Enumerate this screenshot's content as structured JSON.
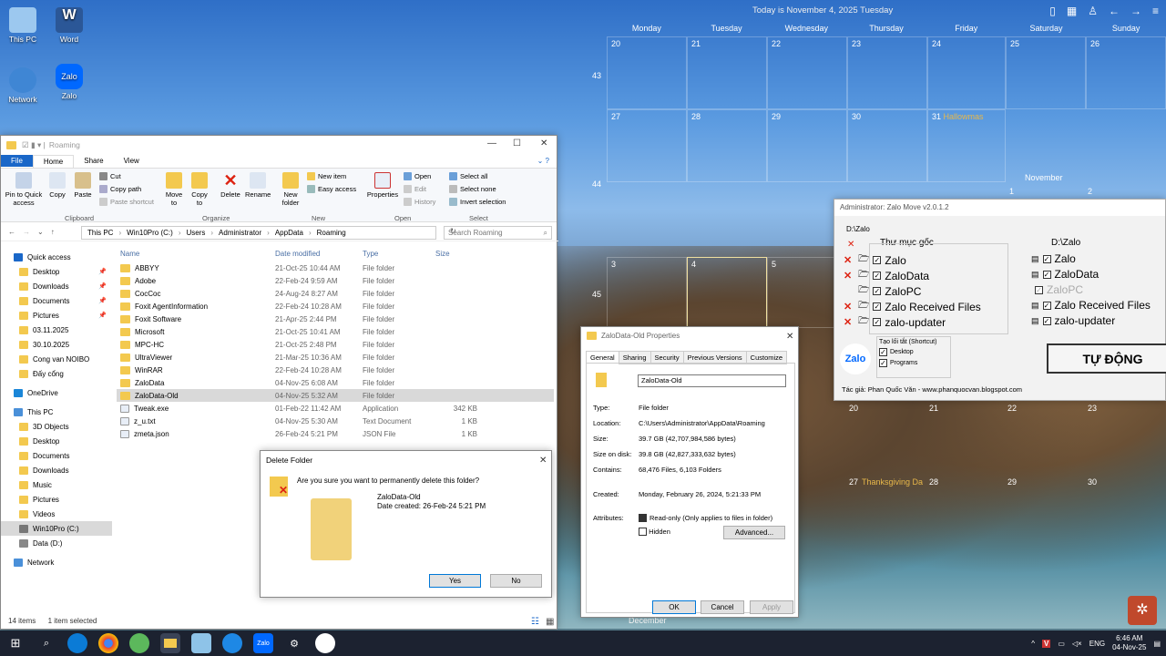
{
  "desktop": {
    "icons": [
      {
        "label": "This PC"
      },
      {
        "label": "Word"
      },
      {
        "label": "Network"
      },
      {
        "label": "Zalo"
      }
    ]
  },
  "calendar": {
    "today": "Today is November 4, 2025 Tuesday",
    "days": [
      "Monday",
      "Tuesday",
      "Wednesday",
      "Thursday",
      "Friday",
      "Saturday",
      "Sunday"
    ],
    "weeks": [
      "43",
      "44",
      "45"
    ],
    "row1": [
      "20",
      "21",
      "22",
      "23",
      "24",
      "25",
      "26"
    ],
    "row2": [
      "27",
      "28",
      "29",
      "30",
      "31",
      "",
      ""
    ],
    "event_halloween": "Hallowmas",
    "month_label": "November",
    "row2b": [
      "1",
      "2"
    ],
    "row3": [
      "3",
      "4",
      "5"
    ],
    "row4": [
      "20",
      "21",
      "22",
      "23"
    ],
    "row5": [
      "27",
      "28",
      "29",
      "30"
    ],
    "event_thanks": "Thanksgiving Da",
    "december": "December"
  },
  "explorer": {
    "title": "Roaming",
    "tabs": [
      "File",
      "Home",
      "Share",
      "View"
    ],
    "ribbon": {
      "pin": "Pin to Quick access",
      "copy": "Copy",
      "paste": "Paste",
      "cut": "Cut",
      "copy_path": "Copy path",
      "paste_shortcut": "Paste shortcut",
      "clipboard": "Clipboard",
      "move_to": "Move to",
      "copy_to": "Copy to",
      "delete": "Delete",
      "rename": "Rename",
      "organize": "Organize",
      "new_folder": "New folder",
      "new_item": "New item",
      "easy_access": "Easy access",
      "new": "New",
      "properties": "Properties",
      "open": "Open",
      "edit": "Edit",
      "history": "History",
      "open_grp": "Open",
      "select_all": "Select all",
      "select_none": "Select none",
      "invert": "Invert selection",
      "select": "Select"
    },
    "path": [
      "This PC",
      "Win10Pro (C:)",
      "Users",
      "Administrator",
      "AppData",
      "Roaming"
    ],
    "search": "Search Roaming",
    "nav": [
      {
        "label": "Quick access",
        "pin": false
      },
      {
        "label": "Desktop",
        "pin": true
      },
      {
        "label": "Downloads",
        "pin": true
      },
      {
        "label": "Documents",
        "pin": true
      },
      {
        "label": "Pictures",
        "pin": true
      },
      {
        "label": "03.11.2025",
        "pin": false
      },
      {
        "label": "30.10.2025",
        "pin": false
      },
      {
        "label": "Cong van NOIBO",
        "pin": false
      },
      {
        "label": "Đấy cổng",
        "pin": false
      },
      {
        "label": "OneDrive",
        "pin": false
      },
      {
        "label": "This PC",
        "pin": false
      },
      {
        "label": "3D Objects",
        "pin": false
      },
      {
        "label": "Desktop",
        "pin": false
      },
      {
        "label": "Documents",
        "pin": false
      },
      {
        "label": "Downloads",
        "pin": false
      },
      {
        "label": "Music",
        "pin": false
      },
      {
        "label": "Pictures",
        "pin": false
      },
      {
        "label": "Videos",
        "pin": false
      },
      {
        "label": "Win10Pro (C:)",
        "pin": false
      },
      {
        "label": "Data (D:)",
        "pin": false
      },
      {
        "label": "Network",
        "pin": false
      }
    ],
    "columns": [
      "Name",
      "Date modified",
      "Type",
      "Size"
    ],
    "files": [
      [
        "ABBYY",
        "21-Oct-25 10:44 AM",
        "File folder",
        ""
      ],
      [
        "Adobe",
        "22-Feb-24 9:59 AM",
        "File folder",
        ""
      ],
      [
        "CocCoc",
        "24-Aug-24 8:27 AM",
        "File folder",
        ""
      ],
      [
        "Foxit AgentInformation",
        "22-Feb-24 10:28 AM",
        "File folder",
        ""
      ],
      [
        "Foxit Software",
        "21-Apr-25 2:44 PM",
        "File folder",
        ""
      ],
      [
        "Microsoft",
        "21-Oct-25 10:41 AM",
        "File folder",
        ""
      ],
      [
        "MPC-HC",
        "21-Oct-25 2:48 PM",
        "File folder",
        ""
      ],
      [
        "UltraViewer",
        "21-Mar-25 10:36 AM",
        "File folder",
        ""
      ],
      [
        "WinRAR",
        "22-Feb-24 10:28 AM",
        "File folder",
        ""
      ],
      [
        "ZaloData",
        "04-Nov-25 6:08 AM",
        "File folder",
        ""
      ],
      [
        "ZaloData-Old",
        "04-Nov-25 5:32 AM",
        "File folder",
        ""
      ],
      [
        "Tweak.exe",
        "01-Feb-22 11:42 AM",
        "Application",
        "342 KB"
      ],
      [
        "z_u.txt",
        "04-Nov-25 5:30 AM",
        "Text Document",
        "1 KB"
      ],
      [
        "zmeta.json",
        "26-Feb-24 5:21 PM",
        "JSON File",
        "1 KB"
      ]
    ],
    "status_items": "14 items",
    "status_selected": "1 item selected"
  },
  "delete_dialog": {
    "title": "Delete Folder",
    "question": "Are you sure you want to permanently delete this folder?",
    "name": "ZaloData-Old",
    "created": "Date created: 26-Feb-24 5:21 PM",
    "yes": "Yes",
    "no": "No"
  },
  "properties": {
    "title": "ZaloData-Old Properties",
    "tabs": [
      "General",
      "Sharing",
      "Security",
      "Previous Versions",
      "Customize"
    ],
    "name": "ZaloData-Old",
    "type_k": "Type:",
    "type": "File folder",
    "loc_k": "Location:",
    "loc": "C:\\Users\\Administrator\\AppData\\Roaming",
    "size_k": "Size:",
    "size": "39.7 GB (42,707,984,586 bytes)",
    "disk_k": "Size on disk:",
    "disk": "39.8 GB (42,827,333,632 bytes)",
    "contains_k": "Contains:",
    "contains": "68,476 Files, 6,103 Folders",
    "created_k": "Created:",
    "created": "Monday, February 26, 2024, 5:21:33 PM",
    "attr_k": "Attributes:",
    "readonly": "Read-only (Only applies to files in folder)",
    "hidden": "Hidden",
    "advanced": "Advanced...",
    "ok": "OK",
    "cancel": "Cancel",
    "apply": "Apply"
  },
  "zalo_move": {
    "title": "Administrator: Zalo Move v2.0.1.2",
    "path_left": "D:\\Zalo",
    "root_label": "Thư mục gốc",
    "path_right": "D:\\Zalo",
    "left": [
      "Zalo",
      "ZaloData",
      "ZaloPC",
      "Zalo Received Files",
      "zalo-updater"
    ],
    "right": [
      "Zalo",
      "ZaloData",
      "ZaloPC",
      "Zalo Received Files",
      "zalo-updater"
    ],
    "shortcut_label": "Tạo lối tắt (Shortcut)",
    "desktop": "Desktop",
    "programs": "Programs",
    "auto": "TỰ ĐỘNG",
    "author": "Tác giả: Phan Quốc Văn - www.phanquocvan.blogspot.com",
    "logo": "Zalo"
  },
  "taskbar": {
    "lang": "ENG",
    "time": "6:46 AM",
    "date": "04-Nov-25"
  }
}
